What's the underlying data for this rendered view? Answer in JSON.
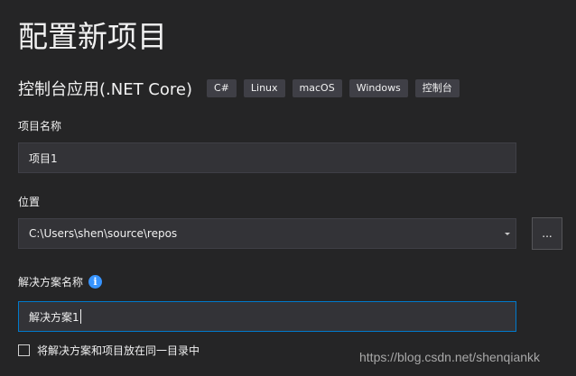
{
  "header": {
    "title": "配置新项目",
    "template_name": "控制台应用(.NET Core)",
    "tags": [
      "C#",
      "Linux",
      "macOS",
      "Windows",
      "控制台"
    ]
  },
  "project_name": {
    "label": "项目名称",
    "value": "项目1"
  },
  "location": {
    "label": "位置",
    "value": "C:\\Users\\shen\\source\\repos",
    "browse_label": "..."
  },
  "solution_name": {
    "label": "解决方案名称",
    "info_glyph": "i",
    "value": "解决方案1"
  },
  "same_directory": {
    "label": "将解决方案和项目放在同一目录中",
    "checked": false
  },
  "watermark": "https://blog.csdn.net/shenqiankk",
  "colors": {
    "background": "#252526",
    "input_background": "#333337",
    "tag_background": "#3f3f46",
    "focus_border": "#007acc",
    "info_icon": "#3794ff"
  }
}
